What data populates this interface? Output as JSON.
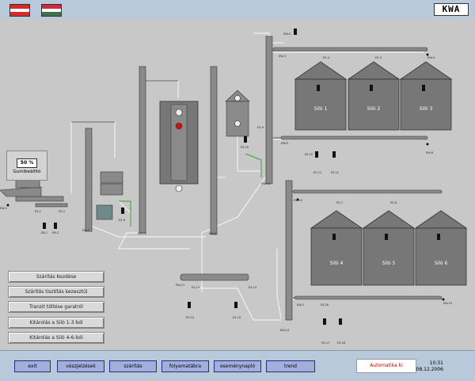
{
  "header": {
    "flags": [
      {
        "name": "austria-flag",
        "colors": [
          "#d72a2a",
          "#ffffff",
          "#d72a2a"
        ]
      },
      {
        "name": "hungary-flag",
        "colors": [
          "#cd2a3e",
          "#ffffff",
          "#436f4d"
        ]
      }
    ],
    "logo": "KWA"
  },
  "gauge": {
    "value": "50 %",
    "label": "Gumibeállító"
  },
  "silos": [
    {
      "label": "Siló 1"
    },
    {
      "label": "Siló 2"
    },
    {
      "label": "Siló 3"
    },
    {
      "label": "Siló 4"
    },
    {
      "label": "Siló 5"
    },
    {
      "label": "Siló 6"
    }
  ],
  "tags": {
    "ew1": "EW-1",
    "es1": "ES-1",
    "es2": "ES-2",
    "es3": "ES-3",
    "ebs1": "EB-1",
    "ebs2": "EB-2",
    "ew7": "EW-7",
    "es6": "ES-6",
    "ew10": "EW-10",
    "ew8": "EW-8",
    "es10": "ES-10",
    "es9": "ES-9",
    "ew5": "EW-5",
    "ew3": "EW-3",
    "es4": "ES-4",
    "es5": "ES-5",
    "ew4": "EW-4",
    "es11": "ES-11",
    "es12": "ES-12",
    "ew9": "EW-9",
    "ew6": "EW-6",
    "es7": "ES-7",
    "es8": "ES-8",
    "ew11": "EW-11",
    "ew12": "EW-12",
    "ew13": "EW-13",
    "es14": "ES-14",
    "es13": "ES-13",
    "es15": "ES-15",
    "ew14": "EW-14",
    "ew2": "EW-2",
    "es16": "ES-16",
    "es17": "ES-17",
    "es18": "ES-18",
    "es19": "ES-19",
    "ew15": "EW-15"
  },
  "panel_buttons": [
    "Szárítás Kezdése",
    "Szárítás tisztítás kezesztül",
    "Tranzit töltése garatról",
    "Kitárolás a Siló 1-3 ból",
    "Kitárolás a Siló 4-6-ból"
  ],
  "nav_buttons": [
    "exit",
    "vészjelzések",
    "szárítás",
    "folyamatábra",
    "eseménynapló",
    "trend"
  ],
  "auto_button": "Automatika ki",
  "clock": {
    "time": "10:31",
    "date": "08.12.2006"
  }
}
